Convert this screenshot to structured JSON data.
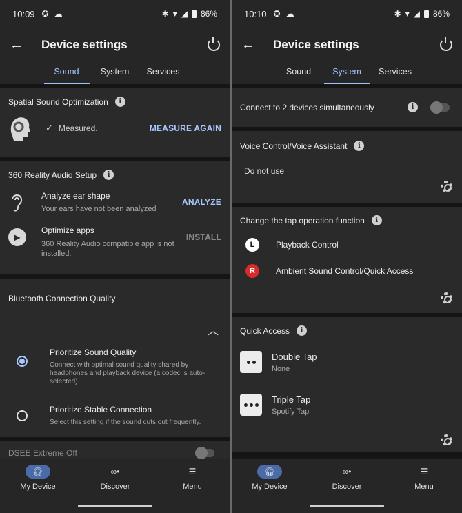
{
  "left": {
    "status": {
      "time": "10:09",
      "battery": "86%"
    },
    "header": {
      "title": "Device settings"
    },
    "tabs": [
      {
        "label": "Sound",
        "active": true
      },
      {
        "label": "System"
      },
      {
        "label": "Services"
      }
    ],
    "spatial": {
      "title": "Spatial Sound Optimization",
      "status": "Measured.",
      "action": "MEASURE AGAIN"
    },
    "reality": {
      "title": "360 Reality Audio Setup",
      "analyze": {
        "title": "Analyze ear shape",
        "subtitle": "Your ears have not been analyzed",
        "action": "ANALYZE"
      },
      "optimize": {
        "title": "Optimize apps",
        "subtitle": "360 Reality Audio compatible app is not installed.",
        "action": "INSTALL"
      }
    },
    "bluetooth": {
      "title": "Bluetooth Connection Quality",
      "options": [
        {
          "title": "Prioritize Sound Quality",
          "desc": "Connect with optimal sound quality shared by headphones and playback device (a codec is auto-selected).",
          "selected": true
        },
        {
          "title": "Prioritize Stable Connection",
          "desc": "Select this setting if the sound cuts out frequently.",
          "selected": false
        }
      ]
    },
    "partial": {
      "label": "DSEE Extreme  Off"
    }
  },
  "right": {
    "status": {
      "time": "10:10",
      "battery": "86%"
    },
    "header": {
      "title": "Device settings"
    },
    "tabs": [
      {
        "label": "Sound"
      },
      {
        "label": "System",
        "active": true
      },
      {
        "label": "Services"
      }
    ],
    "connect": {
      "title": "Connect to 2 devices simultaneously",
      "enabled": false
    },
    "voice": {
      "title": "Voice Control/Voice Assistant",
      "value": "Do not use"
    },
    "tap": {
      "title": "Change the tap operation function",
      "items": [
        {
          "badge": "L",
          "label": "Playback Control",
          "badge_color": "#ffffff"
        },
        {
          "badge": "R",
          "label": "Ambient Sound Control/Quick Access",
          "badge_color": "#d92b2b"
        }
      ]
    },
    "quick": {
      "title": "Quick Access",
      "items": [
        {
          "title": "Double Tap",
          "value": "None"
        },
        {
          "title": "Triple Tap",
          "value": "Spotify Tap"
        }
      ]
    }
  },
  "nav": [
    {
      "label": "My Device",
      "icon": "headphones-icon",
      "active": true
    },
    {
      "label": "Discover",
      "icon": "binoculars-icon"
    },
    {
      "label": "Menu",
      "icon": "hamburger-icon"
    }
  ],
  "colors": {
    "accent": "#9ec3ff",
    "background": "#151515",
    "card": "#2a2a2a"
  }
}
